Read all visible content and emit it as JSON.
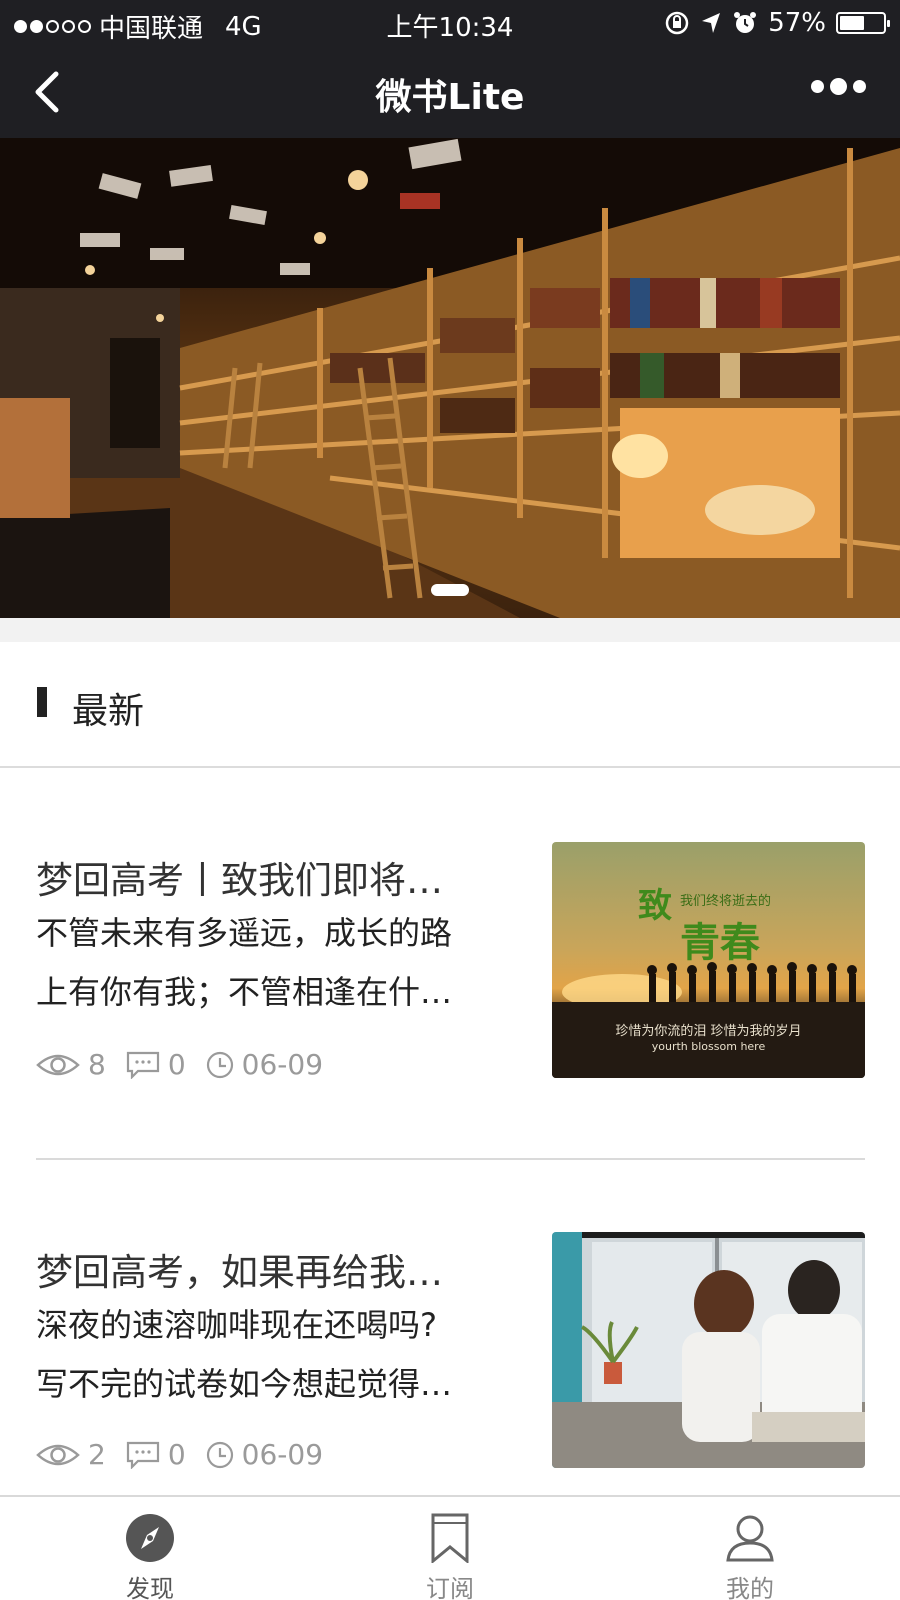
{
  "status_bar": {
    "carrier": "中国联通",
    "network": "4G",
    "time": "上午10:34",
    "battery": "57%",
    "battery_level": 0.57
  },
  "nav": {
    "title": "微书Lite",
    "back_icon": "chevron-left-icon",
    "more_icon": "more-dots-icon"
  },
  "banner": {
    "slide_count": 1,
    "active_slide": 1
  },
  "section": {
    "label": "最新"
  },
  "articles": [
    {
      "title": "梦回高考丨致我们即将…",
      "summary_line1": "不管未来有多遥远，成长的路",
      "summary_line2": "上有你有我；不管相逢在什…",
      "views": "8",
      "comments": "0",
      "date": "06-09",
      "thumb_text_big1": "致",
      "thumb_text_small": "我们终将逝去的",
      "thumb_text_big2": "青春",
      "thumb_caption": "珍惜为你流的泪  珍惜为我的岁月",
      "thumb_caption_en": "yourth  blossom  here"
    },
    {
      "title": "梦回高考，如果再给我…",
      "summary_line1": "深夜的速溶咖啡现在还喝吗?",
      "summary_line2": "写不完的试卷如今想起觉得…",
      "views": "2",
      "comments": "0",
      "date": "06-09"
    }
  ],
  "tabs": [
    {
      "label": "发现",
      "icon": "compass-icon",
      "active": true
    },
    {
      "label": "订阅",
      "icon": "bookmark-icon",
      "active": false
    },
    {
      "label": "我的",
      "icon": "person-icon",
      "active": false
    }
  ]
}
